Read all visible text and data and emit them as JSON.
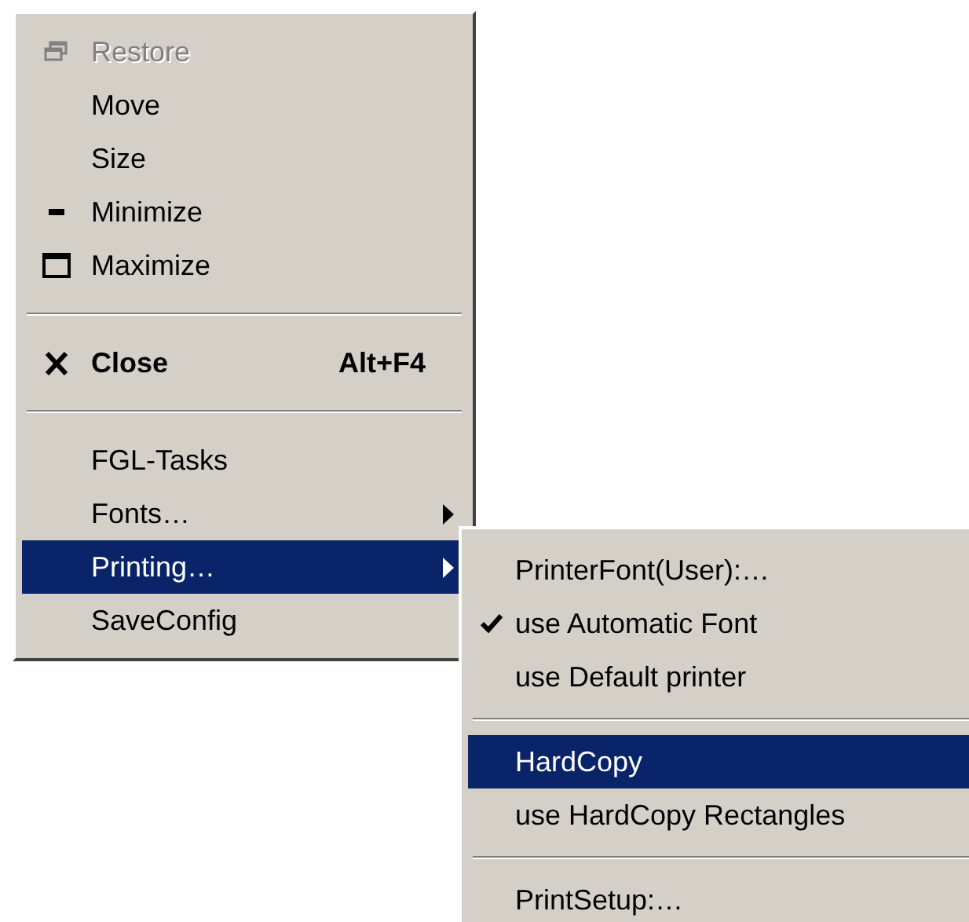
{
  "window_menu": {
    "items": [
      {
        "kind": "restore",
        "label": "Restore",
        "disabled": true,
        "selected": false
      },
      {
        "kind": "plain",
        "label": "Move",
        "disabled": false,
        "selected": false
      },
      {
        "kind": "plain",
        "label": "Size",
        "disabled": false,
        "selected": false
      },
      {
        "kind": "minimize",
        "label": "Minimize",
        "disabled": false,
        "selected": false
      },
      {
        "kind": "maximize",
        "label": "Maximize",
        "disabled": false,
        "selected": false
      },
      {
        "kind": "separator"
      },
      {
        "kind": "close",
        "label": "Close",
        "shortcut": "Alt+F4",
        "disabled": false,
        "selected": false
      },
      {
        "kind": "separator"
      },
      {
        "kind": "plain",
        "label": "FGL-Tasks",
        "disabled": false,
        "selected": false
      },
      {
        "kind": "submenu",
        "label": "Fonts…",
        "disabled": false,
        "selected": false
      },
      {
        "kind": "submenu",
        "label": "Printing…",
        "disabled": false,
        "selected": true
      },
      {
        "kind": "plain",
        "label": "SaveConfig",
        "disabled": false,
        "selected": false
      }
    ]
  },
  "printing_submenu": {
    "items": [
      {
        "kind": "plain",
        "label": "PrinterFont(User):…",
        "checked": false,
        "selected": false
      },
      {
        "kind": "plain",
        "label": "use Automatic Font",
        "checked": true,
        "selected": false
      },
      {
        "kind": "plain",
        "label": "use Default printer",
        "checked": false,
        "selected": false
      },
      {
        "kind": "separator"
      },
      {
        "kind": "plain",
        "label": "HardCopy",
        "checked": false,
        "selected": true
      },
      {
        "kind": "plain",
        "label": "use HardCopy Rectangles",
        "checked": false,
        "selected": false
      },
      {
        "kind": "separator"
      },
      {
        "kind": "plain",
        "label": "PrintSetup:…",
        "checked": false,
        "selected": false
      }
    ]
  }
}
